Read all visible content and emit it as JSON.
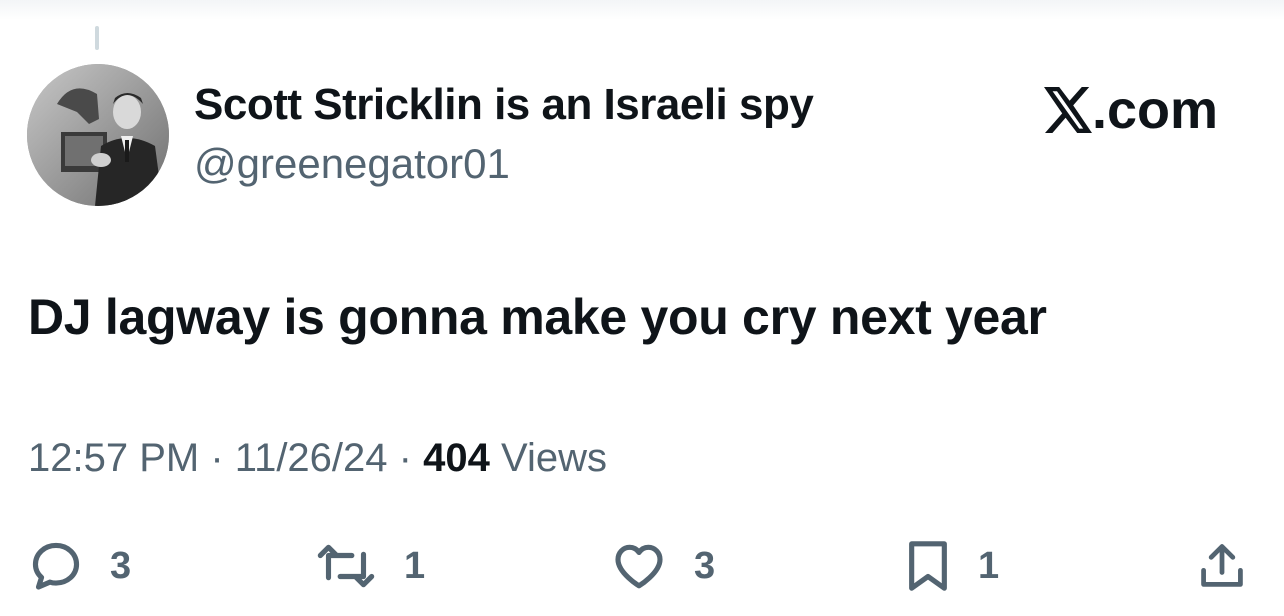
{
  "tweet": {
    "display_name": "Scott Stricklin is an Israeli spy",
    "handle": "@greenegator01",
    "text": "DJ lagway is gonna make you cry next year",
    "time": "12:57 PM",
    "date": "11/26/24",
    "views_count": "404",
    "views_label": "Views",
    "separator": "·"
  },
  "brand": {
    "logo_text": ".com"
  },
  "actions": {
    "reply_count": "3",
    "retweet_count": "1",
    "like_count": "3",
    "bookmark_count": "1"
  },
  "icons": [
    "reply-icon",
    "retweet-icon",
    "like-icon",
    "bookmark-icon",
    "share-icon",
    "x-logo-icon"
  ],
  "colors": {
    "text_primary": "#0f1419",
    "text_secondary": "#536471",
    "background": "#ffffff"
  }
}
